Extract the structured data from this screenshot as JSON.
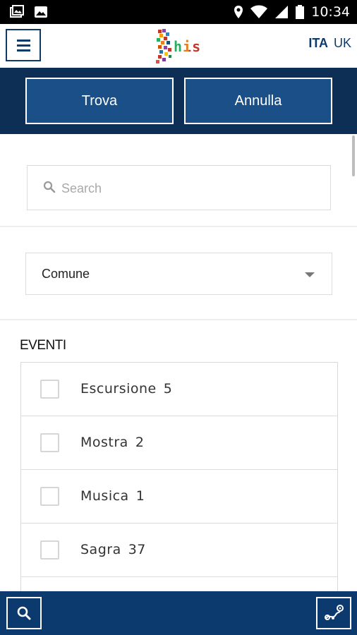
{
  "status_bar": {
    "time": "10:34",
    "left_icons": [
      "gallery-notification-icon",
      "image-notification-icon"
    ],
    "right_icons": [
      "location-icon",
      "wifi-icon",
      "signal-icon",
      "battery-icon"
    ]
  },
  "header": {
    "logo_text": "his",
    "languages": [
      "ITA",
      "UK"
    ],
    "active_language": "ITA"
  },
  "actions": {
    "find_label": "Trova",
    "cancel_label": "Annulla"
  },
  "search": {
    "placeholder": "Search"
  },
  "filter": {
    "selected": "Comune"
  },
  "events_section": {
    "title": "EVENTI",
    "items": [
      {
        "label": "Escursione",
        "count": "5",
        "checked": false
      },
      {
        "label": "Mostra",
        "count": "2",
        "checked": false
      },
      {
        "label": "Musica",
        "count": "1",
        "checked": false
      },
      {
        "label": "Sagra",
        "count": "37",
        "checked": false
      }
    ]
  },
  "colors": {
    "primary_dark": "#0d2e55",
    "primary": "#1a4f87",
    "bottom_bar": "#0d3a6e"
  }
}
